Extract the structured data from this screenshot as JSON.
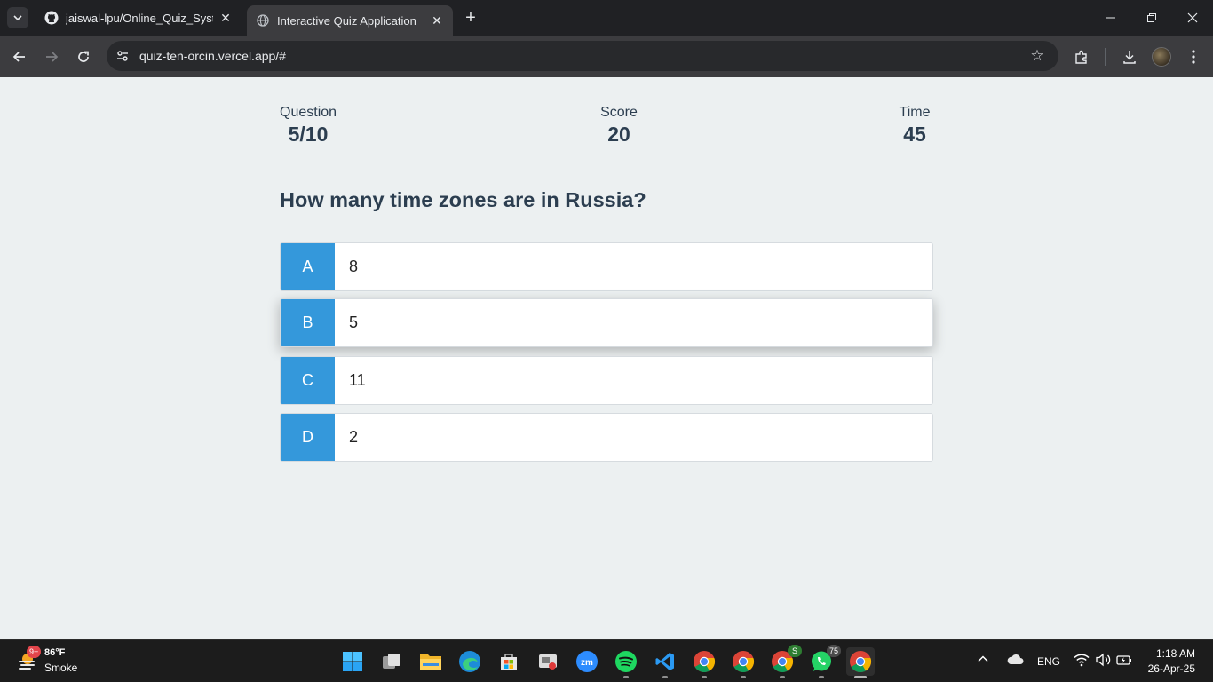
{
  "browser": {
    "tabs": [
      {
        "title": "jaiswal-lpu/Online_Quiz_System",
        "icon": "github-icon",
        "active": false
      },
      {
        "title": "Interactive Quiz Application",
        "icon": "globe-icon",
        "active": true
      }
    ],
    "url": "quiz-ten-orcin.vercel.app/#"
  },
  "quiz": {
    "stats": {
      "question_label": "Question",
      "question_value": "5/10",
      "score_label": "Score",
      "score_value": "20",
      "time_label": "Time",
      "time_value": "45"
    },
    "question": "How many time zones are in Russia?",
    "options": [
      {
        "letter": "A",
        "text": "8"
      },
      {
        "letter": "B",
        "text": "5"
      },
      {
        "letter": "C",
        "text": "11"
      },
      {
        "letter": "D",
        "text": "2"
      }
    ],
    "colors": {
      "accent": "#3498db",
      "text": "#2c3e50",
      "background": "#ecf0f1"
    }
  },
  "taskbar": {
    "weather": {
      "badge": "9+",
      "temp": "86°F",
      "desc": "Smoke"
    },
    "apps": [
      {
        "name": "start-icon"
      },
      {
        "name": "task-view-icon"
      },
      {
        "name": "file-explorer-icon"
      },
      {
        "name": "edge-icon"
      },
      {
        "name": "microsoft-store-icon"
      },
      {
        "name": "snipping-tool-icon"
      },
      {
        "name": "zoom-icon"
      },
      {
        "name": "spotify-icon"
      },
      {
        "name": "vscode-icon"
      },
      {
        "name": "chrome-icon"
      },
      {
        "name": "chrome-icon"
      },
      {
        "name": "chrome-icon",
        "badge": "S"
      },
      {
        "name": "whatsapp-icon",
        "badge": "75"
      },
      {
        "name": "chrome-icon",
        "active": true
      }
    ],
    "language": "ENG",
    "time": "1:18 AM",
    "date": "26-Apr-25"
  }
}
